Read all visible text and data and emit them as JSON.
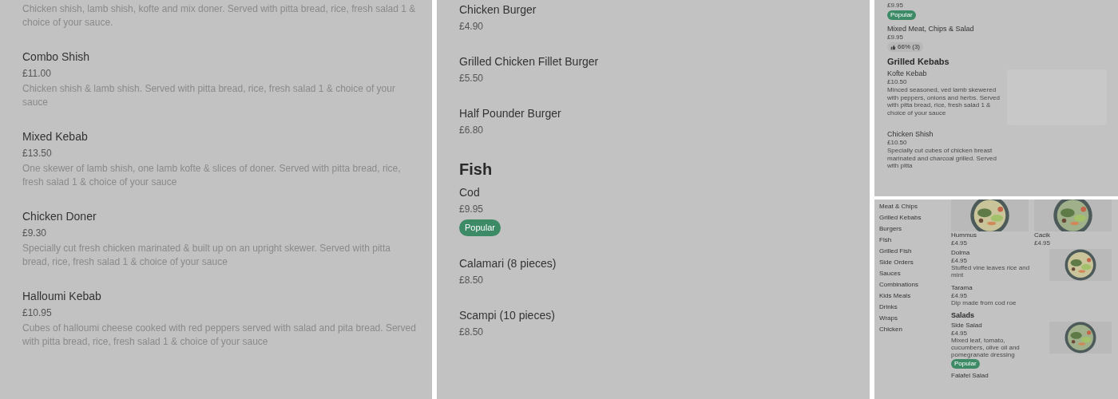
{
  "panels": [
    {
      "kind": "large",
      "blocks": [
        {
          "kind": "item",
          "description": "Chicken shish, lamb shish, kofte and mix doner. Served with pitta bread, rice, fresh salad 1 & choice of your sauce."
        },
        {
          "kind": "item",
          "name": "Combo Shish",
          "price": "£11.00",
          "description": "Chicken shish & lamb shish. Served with pitta bread, rice, fresh salad 1 & choice of your sauce"
        },
        {
          "kind": "item",
          "name": "Mixed Kebab",
          "price": "£13.50",
          "description": "One skewer of lamb shish, one lamb kofte & slices of doner. Served with pitta bread, rice, fresh salad 1 & choice of your sauce"
        },
        {
          "kind": "item",
          "name": "Chicken Doner",
          "price": "£9.30",
          "description": "Specially cut fresh chicken marinated & built up on an upright skewer. Served with pitta bread, rice, fresh salad 1 & choice of your sauce"
        },
        {
          "kind": "item",
          "name": "Halloumi Kebab",
          "price": "£10.95",
          "description": "Cubes of halloumi cheese cooked with red peppers served with salad and pita bread. Served with pitta bread, rice, fresh salad 1 & choice of your sauce"
        }
      ]
    },
    {
      "kind": "large",
      "blocks": [
        {
          "kind": "item",
          "name": "Chicken Burger",
          "price": "£4.90"
        },
        {
          "kind": "item",
          "name": "Grilled Chicken Fillet Burger",
          "price": "£5.50"
        },
        {
          "kind": "item",
          "name": "Half Pounder Burger",
          "price": "£6.80"
        },
        {
          "kind": "heading",
          "text": "Fish"
        },
        {
          "kind": "item",
          "name": "Cod",
          "price": "£9.95",
          "badge": "Popular"
        },
        {
          "kind": "item",
          "name": "Calamari (8 pieces)",
          "price": "£8.50"
        },
        {
          "kind": "item",
          "name": "Scampi (10 pieces)",
          "price": "£8.50"
        }
      ]
    },
    {
      "kind": "small",
      "blocks": [
        {
          "kind": "item",
          "price": "£9.95",
          "badge": "Popular"
        },
        {
          "kind": "item",
          "name": "Mixed Meat, Chips & Salad",
          "price": "£9.95",
          "rating": "66% (3)"
        },
        {
          "kind": "heading",
          "text": "Grilled Kebabs"
        },
        {
          "kind": "item",
          "name": "Kofte Kebab",
          "price": "£10.50",
          "description": "Minced seasoned, ved lamb skewered with peppers, onions and herbs. Served with pitta bread, rice, fresh salad 1 & choice of your sauce",
          "image": {
            "kind": "placeholder"
          }
        },
        {
          "kind": "item",
          "name": "Chicken Shish",
          "price": "£10.50",
          "description": "Specially cut cubes of chicken breast marinated and charcoal grilled. Served with pitta"
        }
      ]
    },
    {
      "kind": "browse",
      "nav": [
        "Meat & Chips",
        "Grilled Kebabs",
        "Burgers",
        "Fish",
        "Grilled Fish",
        "Side Orders",
        "Sauces",
        "Combinations",
        "Kids Meals",
        "Drinks",
        "Wraps",
        "Chicken"
      ],
      "tiles": [
        {
          "name": "Hummus",
          "price": "£4.95"
        },
        {
          "name": "Cacik",
          "price": "£4.95"
        }
      ],
      "blocks": [
        {
          "kind": "item",
          "name": "Dolma",
          "price": "£4.95",
          "description": "Stuffed vine leaves rice and mint"
        },
        {
          "kind": "item",
          "name": "Tarama",
          "price": "£4.95",
          "description": "Dip made from cod roe"
        },
        {
          "kind": "heading",
          "text": "Salads"
        },
        {
          "kind": "item",
          "name": "Side Salad",
          "price": "£4.95",
          "description": "Mixed leaf, tomato, cucumbers, olive oil and pomegranate dressing",
          "badge": "Popular"
        },
        {
          "kind": "item",
          "name": "Falafel Salad"
        }
      ]
    }
  ]
}
